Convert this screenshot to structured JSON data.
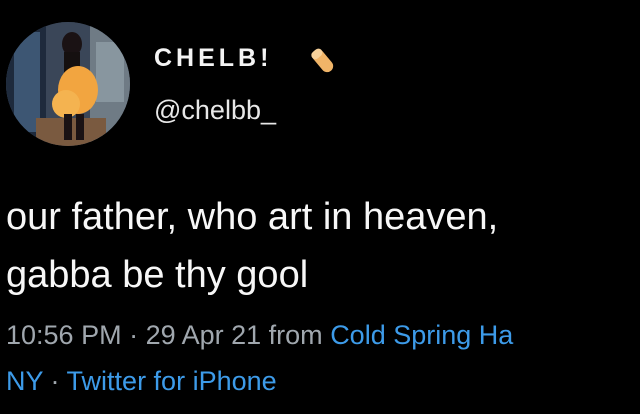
{
  "tweet": {
    "display_name": "CHELB!",
    "handle": "@chelbb_",
    "text_line1": "our father, who art in heaven,",
    "text_line2": "gabba be thy gool",
    "time": "10:56 PM",
    "sep1": " · ",
    "date": "29 Apr 21",
    "from_label": " from ",
    "location_part1": "Cold Spring Ha",
    "location_part2": "NY",
    "sep2": " · ",
    "client": "Twitter for iPhone"
  },
  "icons": {
    "name_emoji": "nail-polish-icon"
  },
  "colors": {
    "background": "#000000",
    "text": "#f7f7f7",
    "secondary": "#a0a7ae",
    "link": "#3d9be9"
  }
}
